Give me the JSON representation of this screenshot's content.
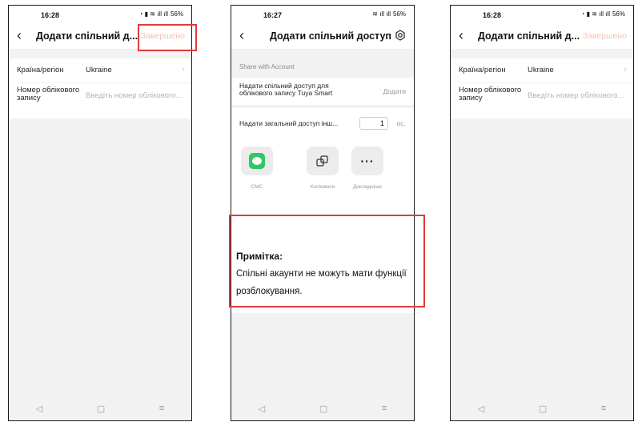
{
  "status_left": {
    "time": "16:28",
    "battery": "56%"
  },
  "status_mid": {
    "time": "16:27",
    "battery": "56%"
  },
  "status_right": {
    "time": "16:28",
    "battery": "56%"
  },
  "add_account_screen": {
    "title": "Додати спільний д...",
    "done_label": "Завершено",
    "country_label": "Країна/регіон",
    "country_value": "Ukraine",
    "account_label": "Номер облікового запису",
    "account_placeholder": "Введіть номер облікового..."
  },
  "share_screen": {
    "title": "Додати спільний доступ",
    "section_header": "Share with Account",
    "tuya_share_label": "Надати спільний доступ для облікового запису Tuya Smart",
    "tuya_share_action": "Додати",
    "general_share_label": "Надати загальний доступ інш...",
    "general_share_count": "1",
    "general_share_unit": "ос.",
    "apps": [
      {
        "label": "СМС",
        "icon": "sms-icon"
      },
      {
        "label": "Копіювати",
        "icon": "copy-icon"
      },
      {
        "label": "Докладніше",
        "icon": "more-icon"
      }
    ],
    "note_title": "Примітка:",
    "note_text": "Спільні акаунти не можуть мати функції розблокування."
  },
  "colors": {
    "done_disabled": "#f6c0b4",
    "highlight_box": "#e23b3b",
    "sms_green": "#2fc862"
  }
}
